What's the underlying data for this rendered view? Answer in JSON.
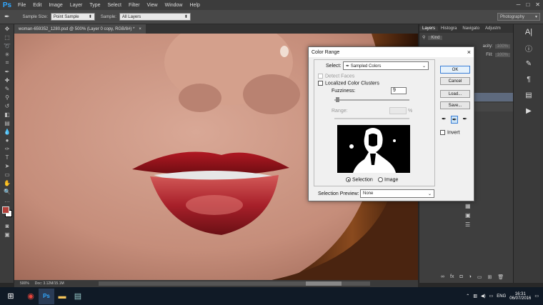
{
  "app": {
    "logo": "Ps"
  },
  "menu": [
    "File",
    "Edit",
    "Image",
    "Layer",
    "Type",
    "Select",
    "Filter",
    "View",
    "Window",
    "Help"
  ],
  "window_controls": {
    "minimize": "─",
    "maximize": "□",
    "close": "✕"
  },
  "options_bar": {
    "sample_size_label": "Sample Size:",
    "sample_size_value": "Point Sample",
    "sample_label": "Sample:",
    "sample_value": "All Layers",
    "workspace": "Photography"
  },
  "document": {
    "tab_title": "woman-659352_1280.psd @ 500% (Layer 0 copy, RGB/8#) *",
    "tab_close": "×",
    "zoom": "500%",
    "doc_info": "Doc: 3.12M/15.1M"
  },
  "panels": {
    "tabs": [
      "Layers",
      "Histogra",
      "Navigato",
      "Adjustm"
    ],
    "kind_label": "Kind",
    "opacity_label": "acity:",
    "opacity_value": "100%",
    "fill_label": "Fill:",
    "fill_value": "100%"
  },
  "dialog": {
    "title": "Color Range",
    "close": "×",
    "select_label": "Select:",
    "select_value": "Sampled Colors",
    "detect_faces": "Detect Faces",
    "localized": "Localized Color Clusters",
    "fuzziness_label": "Fuzziness:",
    "fuzziness_value": "9",
    "range_label": "Range:",
    "range_unit": "%",
    "buttons": {
      "ok": "OK",
      "cancel": "Cancel",
      "load": "Load...",
      "save": "Save..."
    },
    "invert": "Invert",
    "radio_selection": "Selection",
    "radio_image": "Image",
    "preview_label": "Selection Preview:",
    "preview_value": "None"
  },
  "taskbar": {
    "time": "16:31",
    "date": "06/07/2016",
    "lang": "ENG"
  },
  "colors": {
    "foreground": "#b3403a",
    "background": "#ffffff",
    "accent": "#31a8ff"
  }
}
